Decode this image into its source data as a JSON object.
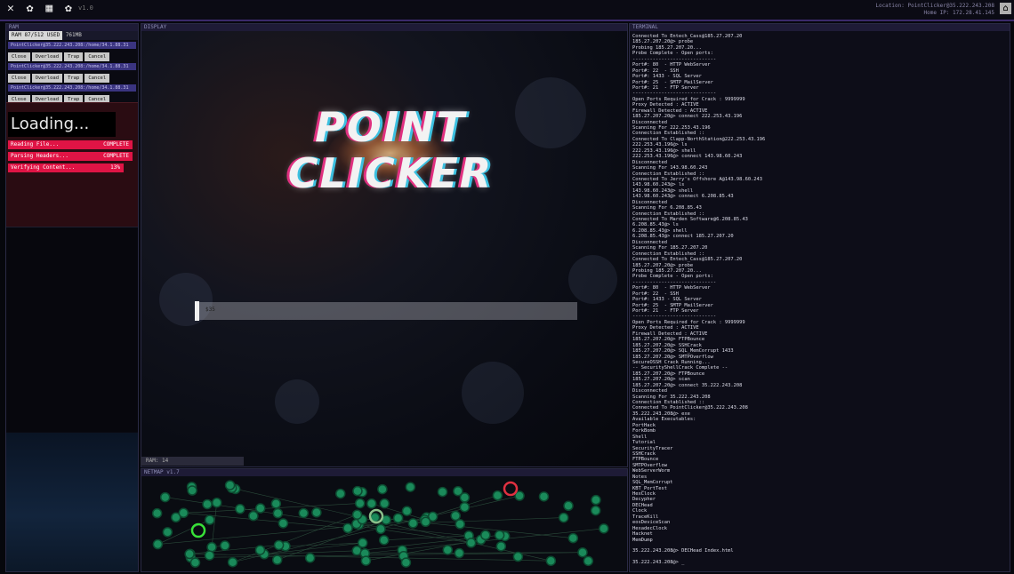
{
  "topbar": {
    "icons": [
      "close-icon",
      "gear-icon",
      "notes-icon",
      "settings-icon"
    ],
    "icon_glyphs": [
      "✕",
      "✿",
      "▦",
      "✿"
    ],
    "version": "v1.0",
    "location": "Location: PointClicker@35.222.243.208",
    "home": "Home IP: 172.28.41.145",
    "exit": "⌂"
  },
  "left_panel": {
    "title": "RAM",
    "ram_used": "RAM 87/512 USED",
    "ram_label": "761MB",
    "exes": [
      {
        "addr": "PointClicker@35.222.243.208:/home/34.1.88.31"
      },
      {
        "addr": "PointClicker@35.222.243.208:/home/34.1.88.31"
      },
      {
        "addr": "PointClicker@35.222.243.208:/home/34.1.88.31"
      }
    ],
    "exe_buttons": [
      "Close",
      "Overload",
      "Trap",
      "Cancel"
    ],
    "loading_title": "Loading...",
    "loading_rows": [
      {
        "label": "Reading File...",
        "value": "COMPLETE"
      },
      {
        "label": "Parsing Headers...",
        "value": "COMPLETE"
      },
      {
        "label": "Verifying Content...",
        "value": "13%"
      }
    ]
  },
  "display": {
    "title": "DISPLAY",
    "logo_line1": "POINT",
    "logo_line2": "CLICKER",
    "progress_pct": 0.0,
    "progress_text": "$35"
  },
  "ram_tab": "RAM: 14",
  "netmap": {
    "title": "NETMAP v1.7",
    "node_color": "#1a8a5a",
    "active_node_color": "#38e038",
    "alert_node_color": "#e03040"
  },
  "terminal": {
    "title": "TERMINAL",
    "lines": [
      "Connected To Entech_Cass@185.27.207.20",
      "185.27.207.20@> probe",
      "Probing 185.27.207.20...",
      "Probe Complete - Open ports:",
      "-----------------------------",
      "Port#: 80  - HTTP WebServer",
      "Port#: 22  - SSH",
      "Port#: 1433 - SQL Server",
      "Port#: 25  - SMTP MailServer",
      "Port#: 21  - FTP Server",
      "-----------------------------",
      "Open Ports Required for Crack : 9999999",
      "Proxy Detected : ACTIVE",
      "Firewall Detected : ACTIVE",
      "185.27.207.20@> connect 222.253.43.196",
      "Disconnected",
      "Scanning For 222.253.43.196",
      "Connection Established ::",
      "Connected To Clapp-NorthStation@222.253.43.196",
      "222.253.43.196@> ls",
      "222.253.43.196@> shell",
      "222.253.43.196@> connect 143.98.60.243",
      "Disconnected",
      "Scanning For 143.98.60.243",
      "Connection Established ::",
      "Connected To Jerry's Offshore A@143.98.60.243",
      "143.98.60.243@> ls",
      "143.98.60.243@> shell",
      "143.98.60.243@> connect 6.208.85.43",
      "Disconnected",
      "Scanning For 6.208.85.43",
      "Connection Established ::",
      "Connected To Marden Software@6.208.85.43",
      "6.208.85.43@> ls",
      "6.208.85.43@> shell",
      "6.208.85.43@> connect 185.27.207.20",
      "Disconnected",
      "Scanning For 185.27.207.20",
      "Connection Established ::",
      "Connected To Entech_Cass@185.27.207.20",
      "185.27.207.20@> probe",
      "Probing 185.27.207.20...",
      "Probe Complete - Open ports:",
      "-----------------------------",
      "Port#: 80  - HTTP WebServer",
      "Port#: 22  - SSH",
      "Port#: 1433 - SQL Server",
      "Port#: 25  - SMTP MailServer",
      "Port#: 21  - FTP Server",
      "-----------------------------",
      "Open Ports Required for Crack : 9999999",
      "Proxy Detected : ACTIVE",
      "Firewall Detected : ACTIVE",
      "185.27.207.20@> FTPBounce",
      "185.27.207.20@> SSHCrack",
      "185.27.207.20@> SQL_MemCorrupt 1433",
      "185.27.207.20@> SMTPOverflow",
      "SecureOSSH Crack Running...",
      "-- SecurityShellCrack Complete --",
      "185.27.207.20@> FTPBounce",
      "185.27.207.20@> scan",
      "185.27.207.20@> connect 35.222.243.208",
      "Disconnected",
      "Scanning For 35.222.243.208",
      "Connection Established ::",
      "Connected To PointClicker@35.222.243.208",
      "35.222.243.208@> exe",
      "Available Executables:",
      "PortHack",
      "ForkBomb",
      "Shell",
      "Tutorial",
      "SecurityTracer",
      "SSHCrack",
      "FTPBounce",
      "SMTPOverflow",
      "WebServerWorm",
      "Notes",
      "SQL_MemCorrupt",
      "KBT_PortTest",
      "HexClock",
      "Decypher",
      "DECHead",
      "Clock",
      "TraceKill",
      "eosDeviceScan",
      "HexadecClock",
      "Hacknet",
      "MemDump",
      "",
      "35.222.243.208@> DECHead Index.html",
      "",
      "35.222.243.208@> _"
    ]
  }
}
